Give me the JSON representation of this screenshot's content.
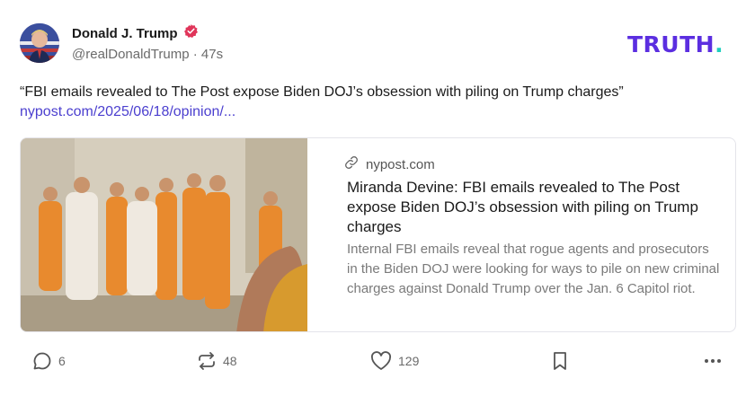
{
  "author": {
    "display_name": "Donald J. Trump",
    "handle": "@realDonaldTrump",
    "separator": "·",
    "time_ago": "47s"
  },
  "brand": {
    "logo_text": "TRUTH",
    "logo_dot": ".",
    "color": "#5b2ee0",
    "dot_color": "#1fcfbf"
  },
  "post": {
    "text": "“FBI emails revealed to The Post expose Biden DOJ’s obsession with piling on Trump charges”",
    "link": "nypost.com/2025/06/18/opinion/..."
  },
  "link_card": {
    "domain": "nypost.com",
    "title": "Miranda Devine: FBI emails revealed to The Post expose Biden DOJ’s obsession with piling on Trump charges",
    "description": "Internal FBI emails reveal that rogue agents and prosecutors in the Biden DOJ were looking for ways to pile on new criminal charges against Donald Trump over the Jan. 6 Capitol riot."
  },
  "actions": {
    "replies": "6",
    "retruths": "48",
    "likes": "129"
  },
  "icons": [
    "verified-badge-icon",
    "link-icon",
    "reply-icon",
    "retruth-icon",
    "like-icon",
    "bookmark-icon",
    "more-icon"
  ],
  "colors": {
    "accent_link": "#4b3fcf",
    "verified": "#e0355a"
  }
}
